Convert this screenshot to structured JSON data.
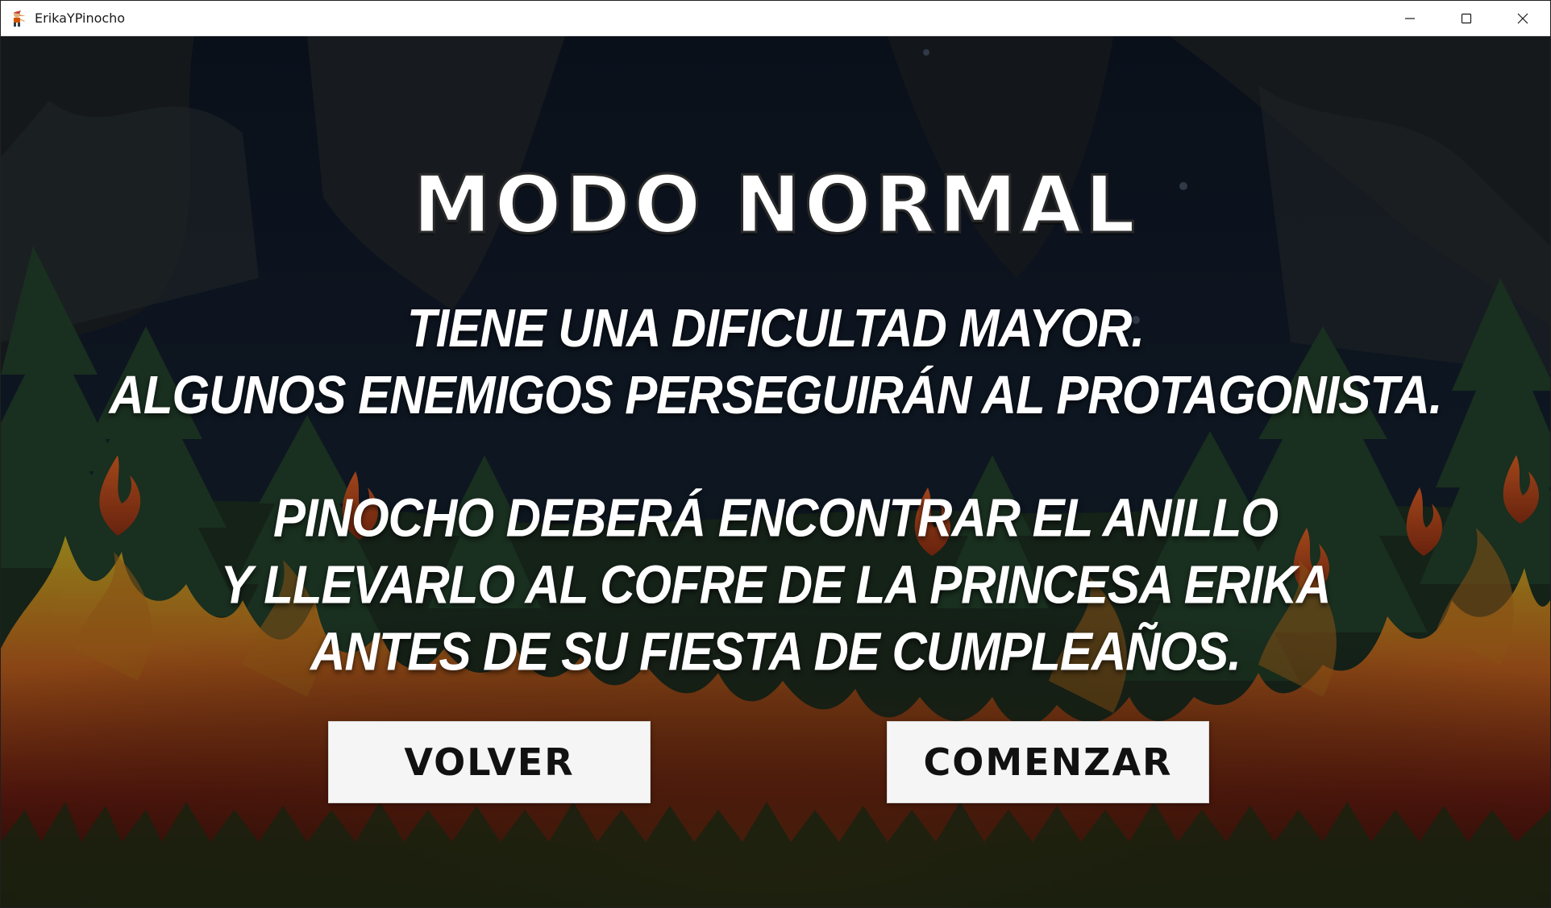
{
  "window": {
    "title": "ErikaYPinocho",
    "app_icon": "pinocchio-icon",
    "controls": {
      "minimize_icon": "minimize-icon",
      "maximize_icon": "maximize-icon",
      "close_icon": "close-icon"
    }
  },
  "screen": {
    "title": "MODO NORMAL",
    "description_block_1": [
      "TIENE UNA DIFICULTAD MAYOR.",
      "ALGUNOS ENEMIGOS PERSEGUIRÁN AL PROTAGONISTA."
    ],
    "description_block_2": [
      "PINOCHO DEBERÁ ENCONTRAR EL ANILLO",
      "Y LLEVARLO AL COFRE DE LA PRINCESA ERIKA",
      "ANTES DE SU FIESTA DE CUMPLEAÑOS."
    ],
    "buttons": {
      "back_label": "VOLVER",
      "start_label": "COMENZAR"
    },
    "background": "burning-forest-night"
  },
  "colors": {
    "text": "#ffffff",
    "button_bg": "#f5f5f5",
    "button_text": "#111111",
    "sky": "#0e1622",
    "fire": "#e8661a"
  }
}
